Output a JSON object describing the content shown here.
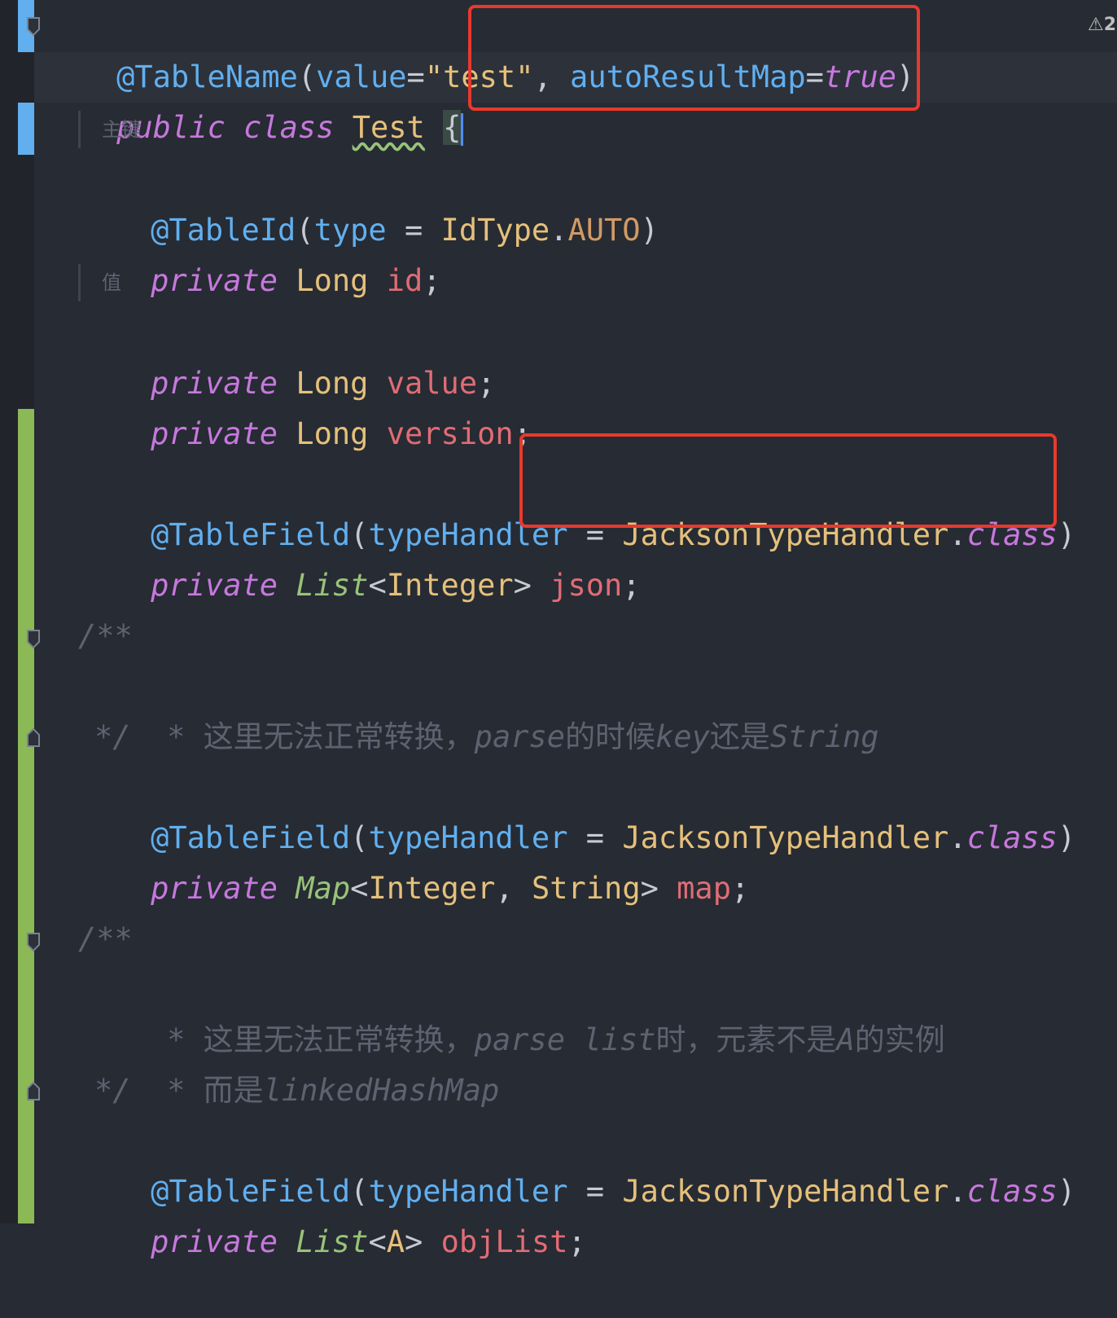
{
  "colors": {
    "background": "#272b33",
    "gutter": "#21252b",
    "vcs_modified": "#61afef",
    "vcs_added": "#8bb956",
    "highlight_box": "#e8392d"
  },
  "warning_indicator": {
    "icon": "warning-triangle-icon",
    "count": "2"
  },
  "code": {
    "l1": {
      "at_name": "@TableName",
      "open": "(",
      "param": "value",
      "eq": "=",
      "str": "\"test\"",
      "comma": ", ",
      "param2": "autoResultMap",
      "eq2": "=",
      "val2": "true",
      "close": ")"
    },
    "l2": {
      "kw1": "public",
      "kw2": "class",
      "name": "Test",
      "brace": "{"
    },
    "hint1": "主键",
    "l3": {
      "at_name": "@TableId",
      "open": "(",
      "param": "type",
      "eq": " = ",
      "type": "IdType",
      "dot": ".",
      "const": "AUTO",
      "close": ")"
    },
    "l4": {
      "kw": "private",
      "type": "Long",
      "field": "id",
      "semi": ";"
    },
    "hint2": "值",
    "l5": {
      "kw": "private",
      "type": "Long",
      "field": "value",
      "semi": ";"
    },
    "l6": {
      "kw": "private",
      "type": "Long",
      "field": "version",
      "semi": ";"
    },
    "l7": {
      "at_name": "@TableField",
      "open": "(",
      "param": "typeHandler",
      "eq": " = ",
      "type": "JacksonTypeHandler",
      "dot": ".",
      "kw": "class",
      "close": ")"
    },
    "l8": {
      "kw": "private",
      "type": "List",
      "lt": "<",
      "inner": "Integer",
      "gt": ">",
      "field": "json",
      "semi": ";"
    },
    "c1": {
      "open": "/**",
      "star": "* ",
      "t1": "这里无法正常转换，",
      "t2": "parse",
      "t3": "的时候",
      "t4": "key",
      "t5": "还是",
      "t6": "String",
      "close": "*/"
    },
    "l9": {
      "at_name": "@TableField",
      "open": "(",
      "param": "typeHandler",
      "eq": " = ",
      "type": "JacksonTypeHandler",
      "dot": ".",
      "kw": "class",
      "close": ")"
    },
    "l10": {
      "kw": "private",
      "type": "Map",
      "lt": "<",
      "inner1": "Integer",
      "comma": ", ",
      "inner2": "String",
      "gt": ">",
      "field": "map",
      "semi": ";"
    },
    "c2": {
      "open": "/**",
      "star": "* ",
      "t1": "这里无法正常转换，",
      "t2": "parse list",
      "t3": "时，元素不是",
      "t4": "A",
      "t5": "的实例",
      "star2": "* ",
      "t6": "而是",
      "t7": "linkedHashMap",
      "close": "*/"
    },
    "l11": {
      "at_name": "@TableField",
      "open": "(",
      "param": "typeHandler",
      "eq": " = ",
      "type": "JacksonTypeHandler",
      "dot": ".",
      "kw": "class",
      "close": ")"
    },
    "l12": {
      "kw": "private",
      "type": "List",
      "lt": "<",
      "inner": "A",
      "gt": ">",
      "field": "objList",
      "semi": ";"
    }
  }
}
